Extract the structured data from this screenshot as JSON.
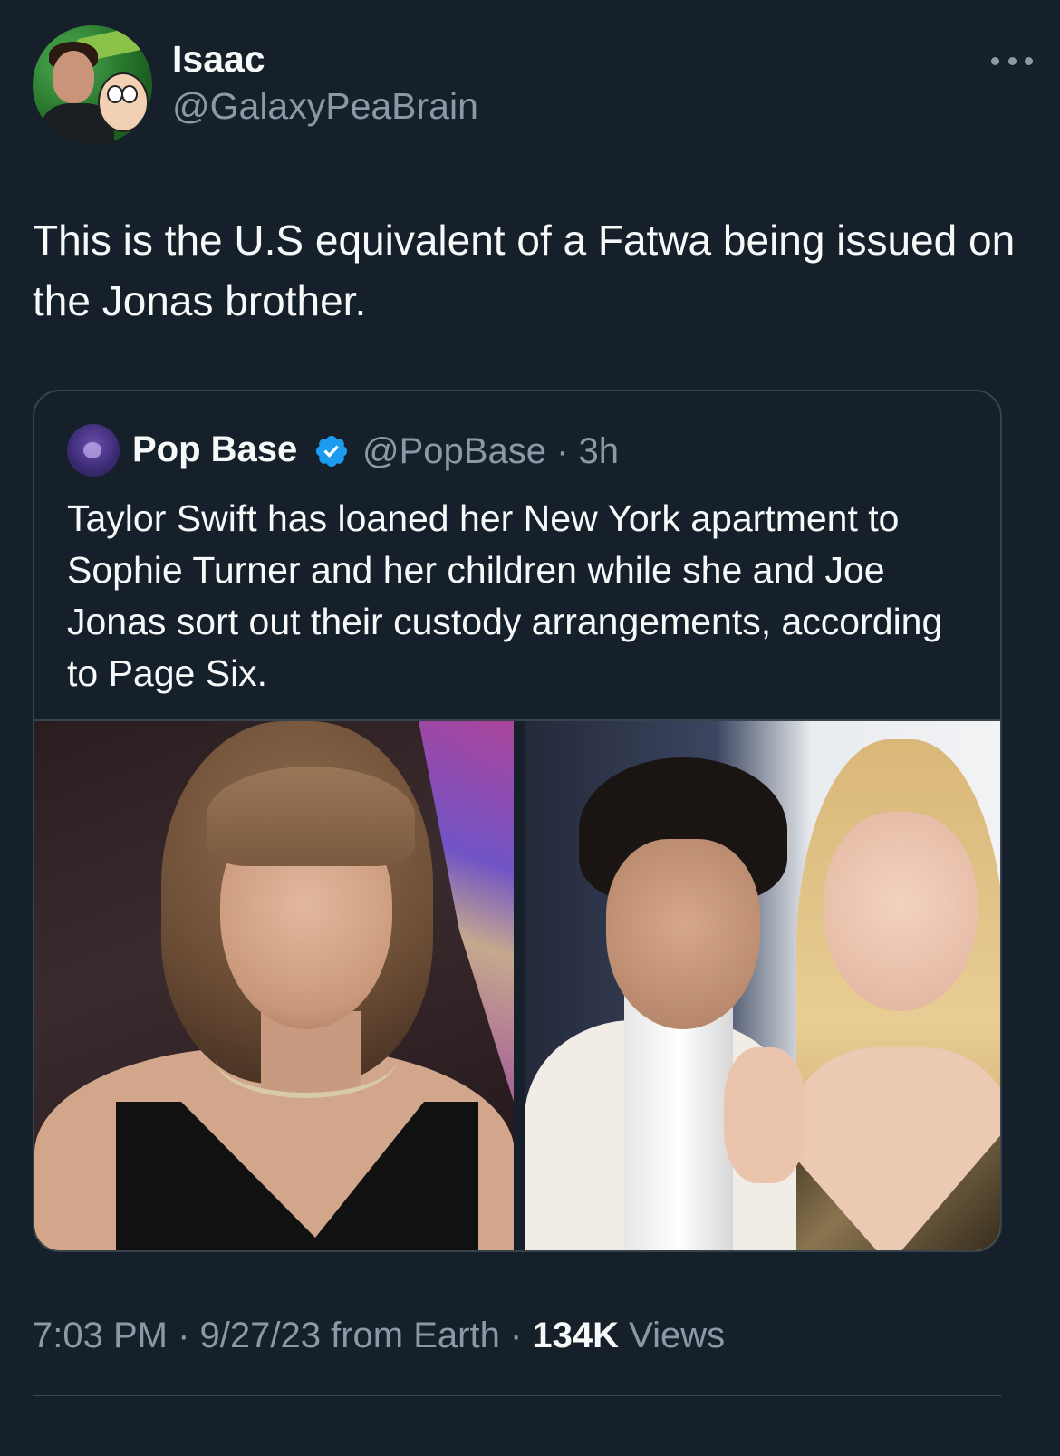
{
  "author": {
    "name": "Isaac",
    "handle": "@GalaxyPeaBrain",
    "avatar_icon": "profile-avatar"
  },
  "more_icon": "more-horizontal-icon",
  "tweet": {
    "text": "This is the U.S equivalent of a Fatwa being issued on the Jonas brother."
  },
  "quoted": {
    "name": "Pop Base",
    "verified_icon": "verified-badge-icon",
    "handle": "@PopBase",
    "separator": " · ",
    "time": "3h",
    "text": "Taylor Swift has loaned her New York apartment to Sophie Turner and her children while she and Joe Jonas sort out their custody arrangements, according to Page Six.",
    "media_count": 2
  },
  "meta": {
    "time": "7:03 PM",
    "sep1": " · ",
    "date": "9/27/23",
    "source": " from Earth",
    "sep2": " · ",
    "views_count": "134K",
    "views_label": " Views"
  },
  "colors": {
    "background": "#15202b",
    "text_primary": "#f7f9f9",
    "text_secondary": "#8b98a5",
    "border": "#38444d",
    "verified": "#1d9bf0"
  }
}
